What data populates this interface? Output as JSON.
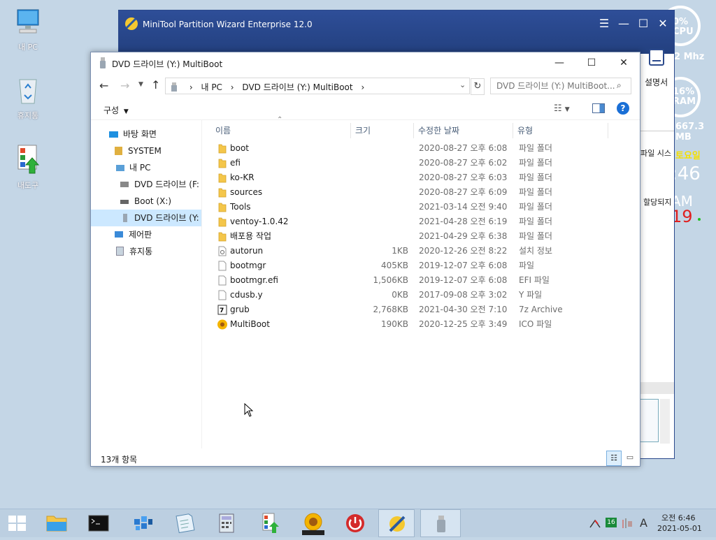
{
  "desktop": {
    "icons": [
      {
        "label": "내 PC",
        "icon": "computer-icon"
      },
      {
        "label": "휴지통",
        "icon": "recycle-bin-icon"
      },
      {
        "label": "내도구",
        "icon": "tools-icon"
      }
    ]
  },
  "widget": {
    "cpu_pct": "0%",
    "cpu_label": "CPU",
    "mhz": "2 Mhz",
    "ram_pct": "16%",
    "ram_label": "RAM",
    "ram_size": "667.3 MB",
    "day": "토요일",
    "time_min": ":46",
    "ampm": "AM",
    "seconds": "19"
  },
  "minitool": {
    "title": "MiniTool Partition Wizard Enterprise 12.0",
    "manual_label": "설명서",
    "file_system_label": "파일 시스",
    "unallocated_label": "할당되지"
  },
  "explorer": {
    "title": "DVD 드라이브 (Y:) MultiBoot",
    "address": [
      "내 PC",
      "DVD 드라이브 (Y:) MultiBoot"
    ],
    "search_placeholder": "DVD 드라이브 (Y:) MultiBoot...",
    "organize_label": "구성",
    "nav": [
      {
        "label": "바탕 화면",
        "icon": "desktop-icon"
      },
      {
        "label": "SYSTEM",
        "icon": "user-folder-icon"
      },
      {
        "label": "내 PC",
        "icon": "computer-icon"
      },
      {
        "label": "DVD 드라이브 (F:",
        "icon": "dvd-drive-icon"
      },
      {
        "label": "Boot (X:)",
        "icon": "drive-icon"
      },
      {
        "label": "DVD 드라이브 (Y:",
        "icon": "usb-drive-icon"
      },
      {
        "label": "제어판",
        "icon": "control-panel-icon"
      },
      {
        "label": "휴지통",
        "icon": "recycle-bin-icon"
      }
    ],
    "columns": [
      "이름",
      "크기",
      "수정한 날짜",
      "유형"
    ],
    "files": [
      {
        "name": "boot",
        "size": "",
        "date": "2020-08-27 오후 6:08",
        "type": "파일 폴더",
        "icon": "folder"
      },
      {
        "name": "efi",
        "size": "",
        "date": "2020-08-27 오후 6:02",
        "type": "파일 폴더",
        "icon": "folder"
      },
      {
        "name": "ko-KR",
        "size": "",
        "date": "2020-08-27 오후 6:03",
        "type": "파일 폴더",
        "icon": "folder"
      },
      {
        "name": "sources",
        "size": "",
        "date": "2020-08-27 오후 6:09",
        "type": "파일 폴더",
        "icon": "folder"
      },
      {
        "name": "Tools",
        "size": "",
        "date": "2021-03-14 오전 9:40",
        "type": "파일 폴더",
        "icon": "folder"
      },
      {
        "name": "ventoy-1.0.42",
        "size": "",
        "date": "2021-04-28 오전 6:19",
        "type": "파일 폴더",
        "icon": "folder"
      },
      {
        "name": "배포용 작업",
        "size": "",
        "date": "2021-04-29 오후 6:38",
        "type": "파일 폴더",
        "icon": "folder"
      },
      {
        "name": "autorun",
        "size": "1KB",
        "date": "2020-12-26 오전 8:22",
        "type": "설치 정보",
        "icon": "settings-file"
      },
      {
        "name": "bootmgr",
        "size": "405KB",
        "date": "2019-12-07 오후 6:08",
        "type": "파일",
        "icon": "file"
      },
      {
        "name": "bootmgr.efi",
        "size": "1,506KB",
        "date": "2019-12-07 오후 6:08",
        "type": "EFI 파일",
        "icon": "file"
      },
      {
        "name": "cdusb.y",
        "size": "0KB",
        "date": "2017-09-08 오후 3:02",
        "type": "Y 파일",
        "icon": "file"
      },
      {
        "name": "grub",
        "size": "2,768KB",
        "date": "2021-04-30 오전 7:10",
        "type": "7z Archive",
        "icon": "archive"
      },
      {
        "name": "MultiBoot",
        "size": "190KB",
        "date": "2020-12-25 오후 3:49",
        "type": "ICO 파일",
        "icon": "sunflower"
      }
    ],
    "status": "13개 항목"
  },
  "taskbar": {
    "apps": [
      "start-icon",
      "file-explorer-icon",
      "cmd-icon",
      "registry-icon",
      "notepad-icon",
      "calculator-icon",
      "tools-icon",
      "imagine-icon",
      "power-icon",
      "partition-wizard-icon",
      "usb-drive-icon"
    ],
    "tray_num": "16",
    "tray_letter": "A",
    "time": "오전 6:46",
    "date": "2021-05-01"
  }
}
